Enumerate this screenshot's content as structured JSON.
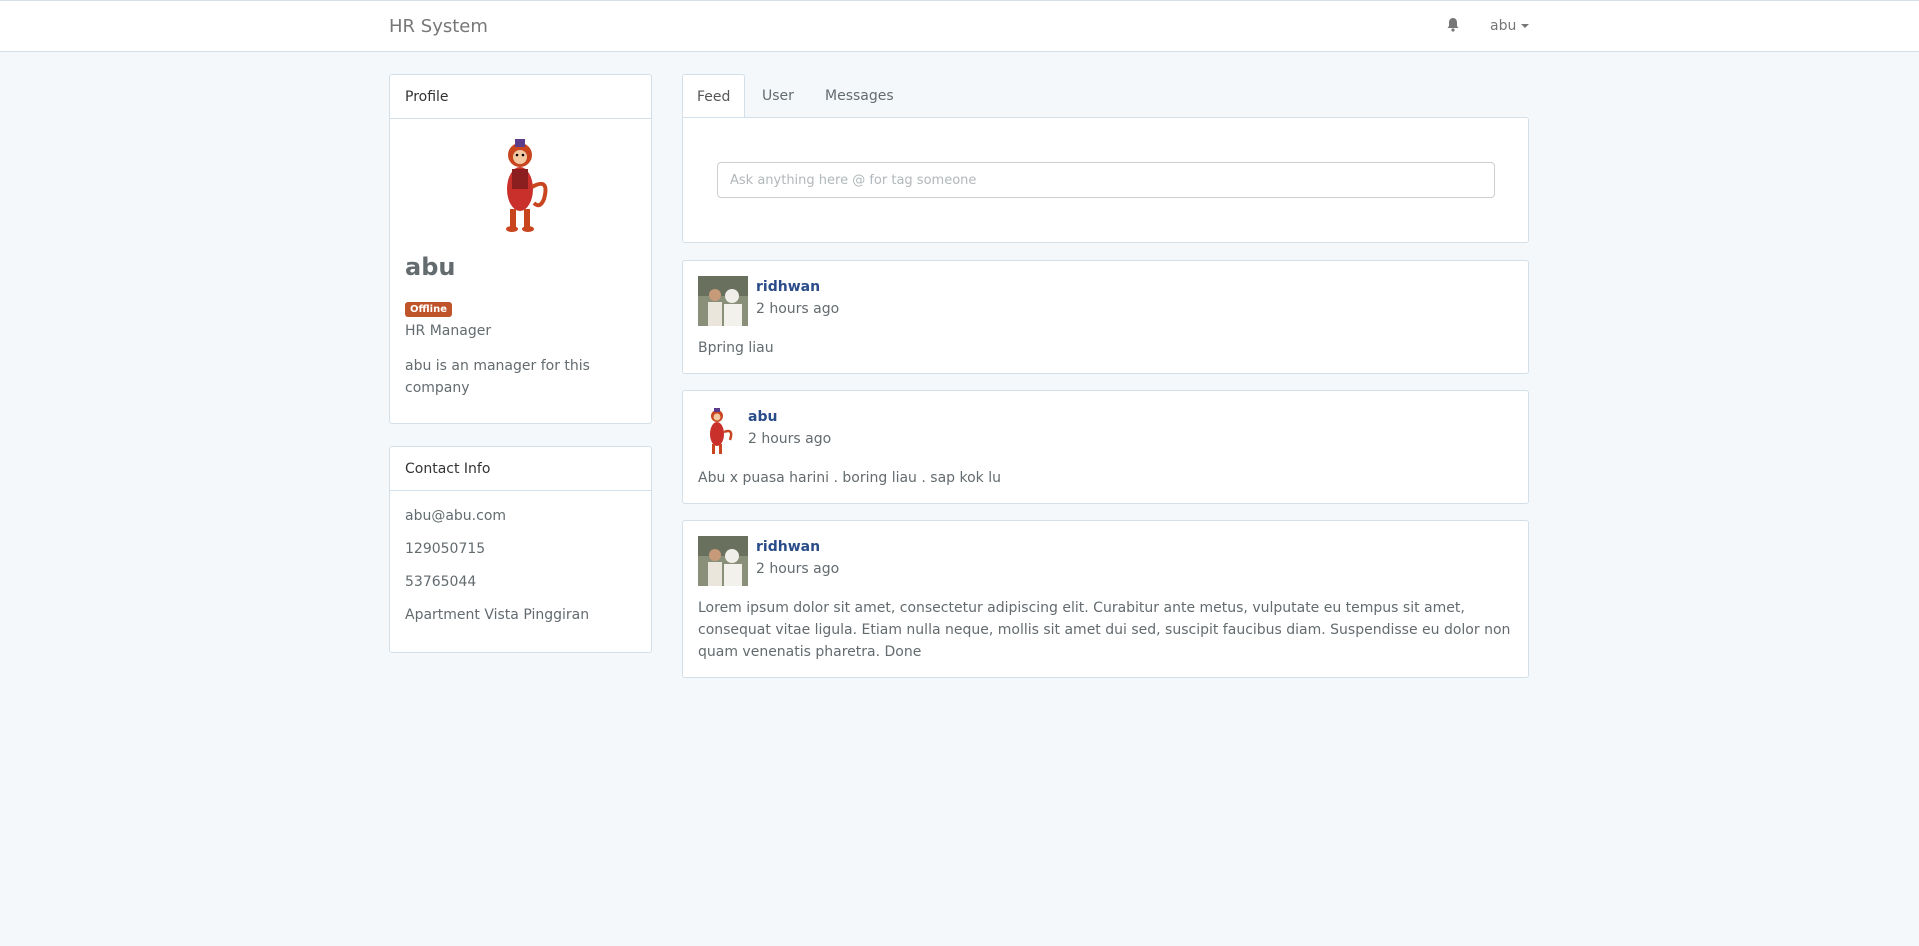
{
  "navbar": {
    "brand": "HR System",
    "user": "abu",
    "bell_icon": "bell-icon",
    "caret_icon": "caret-down-icon"
  },
  "profile": {
    "heading": "Profile",
    "name": "abu",
    "status": "Offline",
    "role": "HR Manager",
    "bio": "abu is an manager for this company"
  },
  "contact": {
    "heading": "Contact Info",
    "email": "abu@abu.com",
    "phone1": "129050715",
    "phone2": "53765044",
    "address": "Apartment Vista Pinggiran"
  },
  "tabs": [
    {
      "label": "Feed",
      "active": true
    },
    {
      "label": "User",
      "active": false
    },
    {
      "label": "Messages",
      "active": false
    }
  ],
  "compose": {
    "placeholder": "Ask anything here @ for tag someone"
  },
  "posts": [
    {
      "author": "ridhwan",
      "time": "2 hours ago",
      "body": "Bpring liau"
    },
    {
      "author": "abu",
      "time": "2 hours ago",
      "body": "Abu x puasa harini . boring liau . sap kok lu"
    },
    {
      "author": "ridhwan",
      "time": "2 hours ago",
      "body": "Lorem ipsum dolor sit amet, consectetur adipiscing elit. Curabitur ante metus, vulputate eu tempus sit amet, consequat vitae ligula. Etiam nulla neque, mollis sit amet dui sed, suscipit faucibus diam. Suspendisse eu dolor non quam venenatis pharetra. Done"
    }
  ],
  "colors": {
    "background": "#f5f8fa",
    "badge_offline": "#bf5329",
    "link": "#2a4d8a"
  }
}
